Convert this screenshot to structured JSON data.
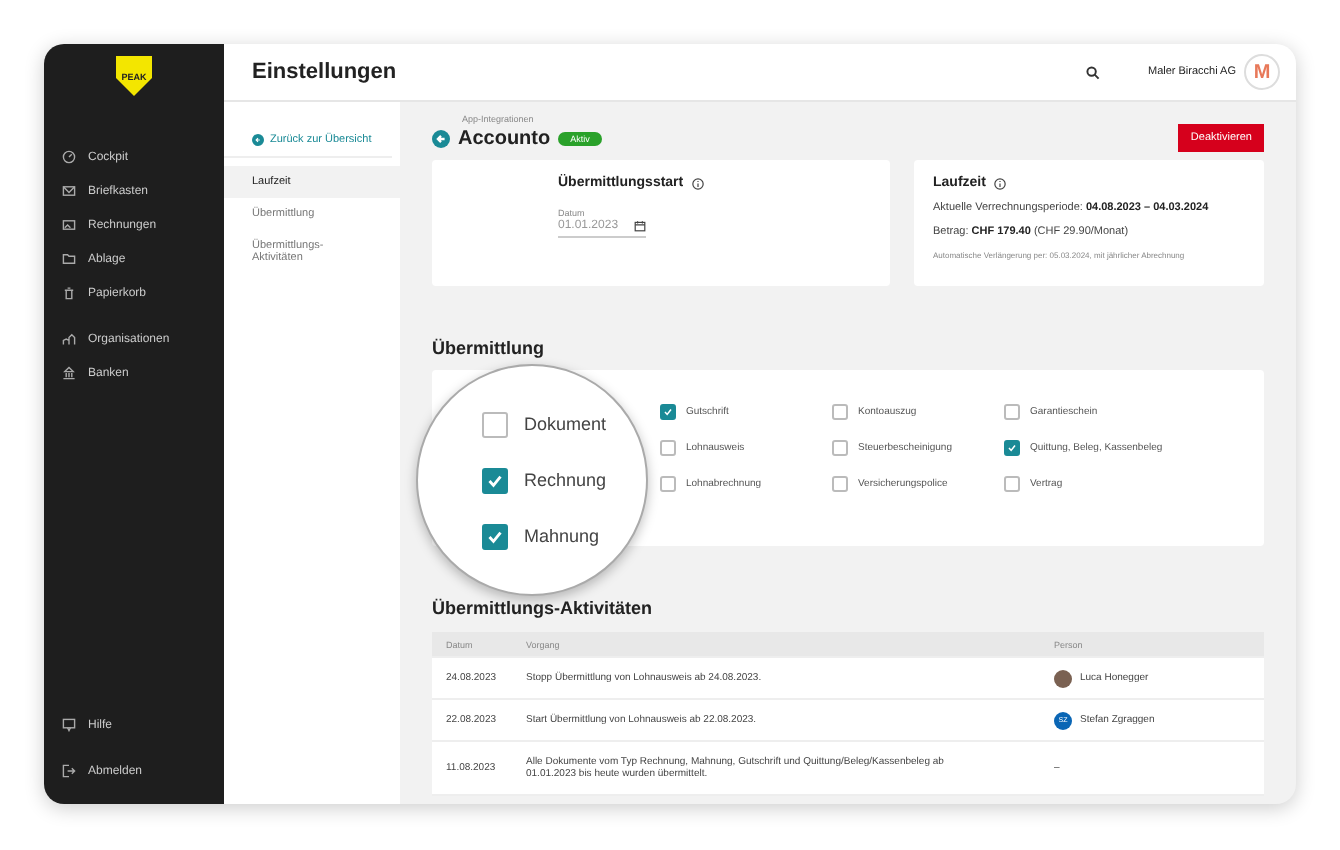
{
  "logo": {
    "text": "PEAK"
  },
  "sidebar": {
    "items": [
      {
        "label": "Cockpit"
      },
      {
        "label": "Briefkasten"
      },
      {
        "label": "Rechnungen"
      },
      {
        "label": "Ablage"
      },
      {
        "label": "Papierkorb"
      },
      {
        "label": "Organisationen"
      },
      {
        "label": "Banken"
      }
    ],
    "footer": [
      {
        "label": "Hilfe"
      },
      {
        "label": "Abmelden"
      }
    ]
  },
  "header": {
    "title": "Einstellungen",
    "company": "Maler Biracchi AG",
    "avatar": "M"
  },
  "submenu": {
    "back": "Zurück zur Übersicht",
    "items": [
      {
        "label": "Laufzeit",
        "selected": true
      },
      {
        "label": "Übermittlung",
        "selected": false
      },
      {
        "label": "Übermittlungs-Aktivitäten",
        "selected": false
      }
    ]
  },
  "page": {
    "breadcrumb": "App-Integrationen",
    "title": "Accounto",
    "status": "Aktiv",
    "action": "Deaktivieren"
  },
  "start_card": {
    "title": "Übermittlungsstart",
    "date_label": "Datum",
    "date": "01.01.2023"
  },
  "term_card": {
    "title": "Laufzeit",
    "period_label": "Aktuelle Verrechnungsperiode:",
    "period": "04.08.2023 – 04.03.2024",
    "amount_label": "Betrag:",
    "amount": "CHF 179.40",
    "amount_note": "(CHF 29.90/Monat)",
    "renewal": "Automatische Verlängerung per: 05.03.2024, mit jährlicher Abrechnung"
  },
  "transfer": {
    "title": "Übermittlung",
    "magnifier": [
      {
        "label": "Dokument",
        "checked": false
      },
      {
        "label": "Rechnung",
        "checked": true
      },
      {
        "label": "Mahnung",
        "checked": true
      }
    ],
    "options": [
      {
        "label": "Gutschrift",
        "checked": true
      },
      {
        "label": "Kontoauszug",
        "checked": false
      },
      {
        "label": "Garantieschein",
        "checked": false
      },
      {
        "label": "Lohnausweis",
        "checked": false
      },
      {
        "label": "Steuerbescheinigung",
        "checked": false
      },
      {
        "label": "Quittung, Beleg, Kassenbeleg",
        "checked": true
      },
      {
        "label": "Lohnabrechnung",
        "checked": false
      },
      {
        "label": "Versicherungspolice",
        "checked": false
      },
      {
        "label": "Vertrag",
        "checked": false
      }
    ]
  },
  "activities": {
    "title": "Übermittlungs-Aktivitäten",
    "columns": [
      "Datum",
      "Vorgang",
      "Person"
    ],
    "rows": [
      {
        "date": "24.08.2023",
        "text": "Stopp Übermittlung von Lohnausweis ab 24.08.2023.",
        "person": "Luca Honegger",
        "kind": "photo"
      },
      {
        "date": "22.08.2023",
        "text": "Start Übermittlung von Lohnausweis ab 22.08.2023.",
        "person": "Stefan Zgraggen",
        "kind": "initials",
        "initials": "SZ"
      },
      {
        "date": "11.08.2023",
        "text": "Alle Dokumente vom Typ Rechnung, Mahnung, Gutschrift und Quittung/Beleg/Kassenbeleg ab 01.01.2023 bis heute wurden übermittelt.",
        "person": "–",
        "kind": "none"
      }
    ]
  }
}
